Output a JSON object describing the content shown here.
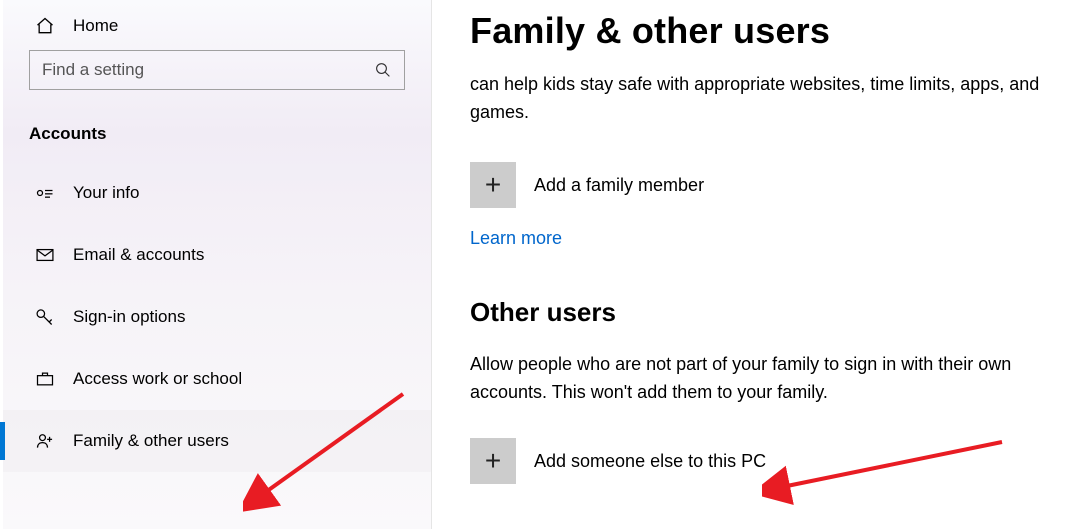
{
  "sidebar": {
    "home_label": "Home",
    "search_placeholder": "Find a setting",
    "section_label": "Accounts",
    "items": [
      {
        "label": "Your info"
      },
      {
        "label": "Email & accounts"
      },
      {
        "label": "Sign-in options"
      },
      {
        "label": "Access work or school"
      },
      {
        "label": "Family & other users"
      }
    ]
  },
  "main": {
    "title": "Family & other users",
    "intro": "can help kids stay safe with appropriate websites, time limits, apps, and games.",
    "add_family_label": "Add a family member",
    "learn_more": "Learn more",
    "other_users_heading": "Other users",
    "other_users_desc": "Allow people who are not part of your family to sign in with their own accounts. This won't add them to your family.",
    "add_other_label": "Add someone else to this PC",
    "plus_glyph": "+"
  }
}
